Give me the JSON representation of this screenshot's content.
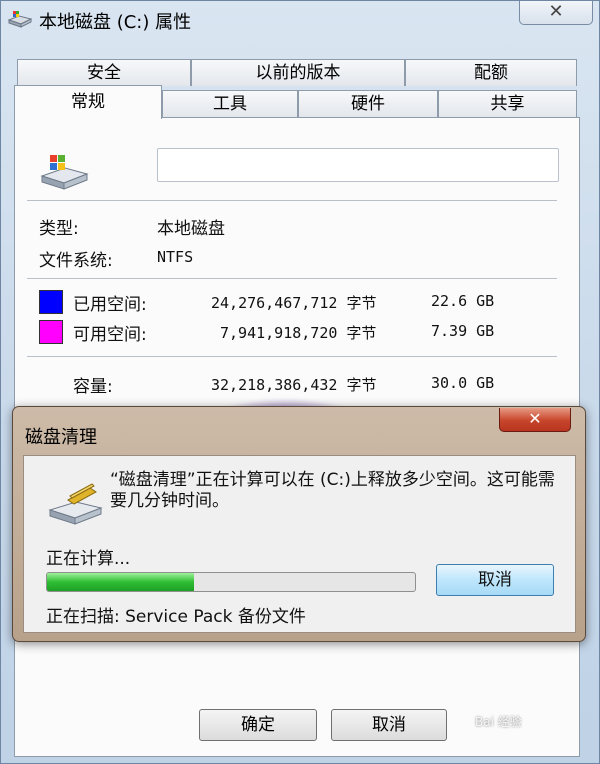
{
  "window": {
    "title": "本地磁盘 (C:) 属性",
    "close_glyph": "✕"
  },
  "tabs": {
    "row_back": [
      "安全",
      "以前的版本",
      "配额"
    ],
    "row_front": [
      "常规",
      "工具",
      "硬件",
      "共享"
    ],
    "active": "常规"
  },
  "general": {
    "volume_label_value": "",
    "type_label": "类型:",
    "type_value": "本地磁盘",
    "fs_label": "文件系统:",
    "fs_value": "NTFS",
    "used": {
      "label": "已用空间:",
      "bytes": "24,276,467,712 字节",
      "size": "22.6 GB",
      "color": "#0000ff"
    },
    "free": {
      "label": "可用空间:",
      "bytes": "7,941,918,720 字节",
      "size": "7.39 GB",
      "color": "#ff00ff"
    },
    "capacity": {
      "label": "容量:",
      "bytes": "32,218,386,432 字节",
      "size": "30.0 GB"
    }
  },
  "buttons": {
    "ok": "确定",
    "cancel": "取消"
  },
  "cleanup_dialog": {
    "title": "磁盘清理",
    "close_glyph": "✕",
    "message": "“磁盘清理”正在计算可以在 (C:)上释放多少空间。这可能需要几分钟时间。",
    "status": "正在计算...",
    "progress_fraction": 0.4,
    "scanning": "正在扫描: Service Pack 备份文件",
    "cancel": "取消"
  },
  "watermark": "Bai 经验",
  "colors": {
    "accent_green": "#2fbe35",
    "close_red": "#c7452b"
  }
}
